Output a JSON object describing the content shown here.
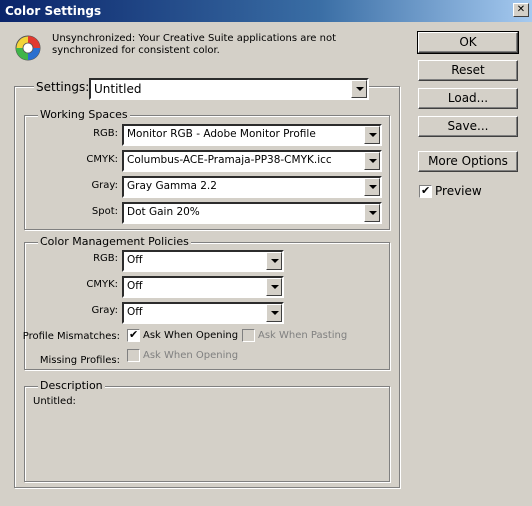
{
  "window": {
    "title": "Color Settings",
    "close_glyph": "✕"
  },
  "sync": {
    "icon": "sync-warning-icon",
    "message": "Unsynchronized: Your Creative Suite applications are not synchronized for consistent color."
  },
  "settings": {
    "label": "Settings:",
    "value": "Untitled"
  },
  "working_spaces": {
    "title": "Working Spaces",
    "rows": [
      {
        "label": "RGB:",
        "value": "Monitor RGB - Adobe Monitor Profile"
      },
      {
        "label": "CMYK:",
        "value": "Columbus-ACE-Pramaja-PP38-CMYK.icc"
      },
      {
        "label": "Gray:",
        "value": "Gray Gamma 2.2"
      },
      {
        "label": "Spot:",
        "value": "Dot Gain 20%"
      }
    ]
  },
  "policies": {
    "title": "Color Management Policies",
    "rows": [
      {
        "label": "RGB:",
        "value": "Off"
      },
      {
        "label": "CMYK:",
        "value": "Off"
      },
      {
        "label": "Gray:",
        "value": "Off"
      }
    ],
    "profile_mismatches": {
      "label": "Profile Mismatches:",
      "ask_opening": "Ask When Opening",
      "ask_pasting": "Ask When Pasting"
    },
    "missing_profiles": {
      "label": "Missing Profiles:",
      "ask_opening": "Ask When Opening"
    }
  },
  "description": {
    "title": "Description",
    "text": "Untitled:"
  },
  "buttons": {
    "ok": "OK",
    "reset": "Reset",
    "load": "Load...",
    "save": "Save...",
    "more_options": "More Options"
  },
  "preview": {
    "label": "Preview",
    "checked": true
  }
}
